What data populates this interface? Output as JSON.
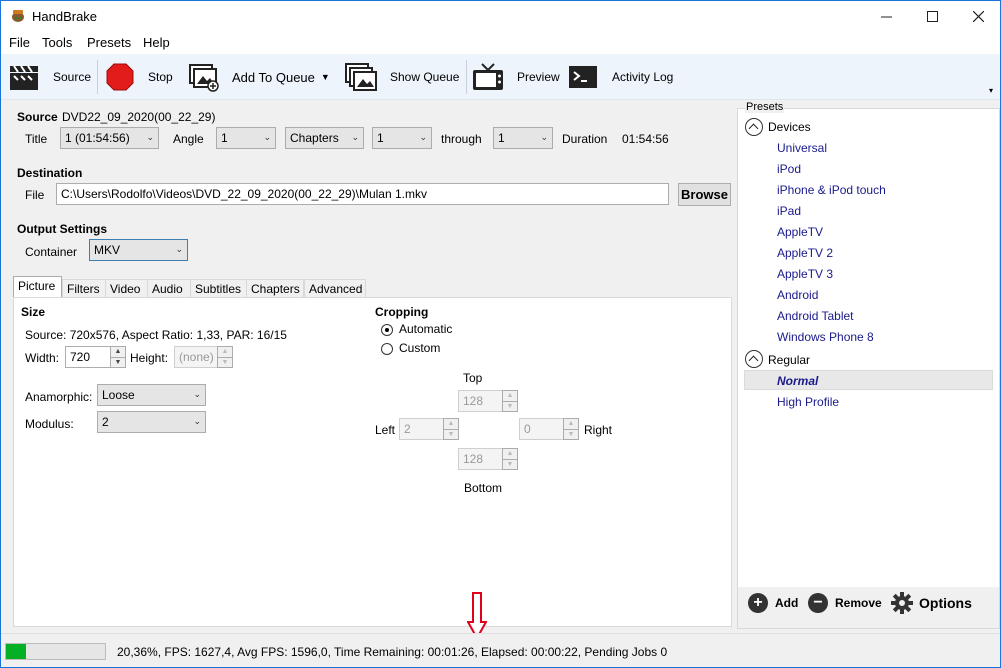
{
  "window": {
    "title": "HandBrake"
  },
  "menu": [
    "File",
    "Tools",
    "Presets",
    "Help"
  ],
  "toolbar": {
    "source": "Source",
    "stop": "Stop",
    "add_to_queue": "Add To Queue",
    "show_queue": "Show Queue",
    "preview": "Preview",
    "activity_log": "Activity Log"
  },
  "source": {
    "heading": "Source",
    "name": "DVD22_09_2020(00_22_29)",
    "title_label": "Title",
    "title_value": "1 (01:54:56)",
    "angle_label": "Angle",
    "angle_value": "1",
    "range_mode": "Chapters",
    "range_start": "1",
    "through_label": "through",
    "range_end": "1",
    "duration_label": "Duration",
    "duration_value": "01:54:56"
  },
  "destination": {
    "heading": "Destination",
    "file_label": "File",
    "file_path": "C:\\Users\\Rodolfo\\Videos\\DVD_22_09_2020(00_22_29)\\Mulan 1.mkv",
    "browse": "Browse"
  },
  "output": {
    "heading": "Output Settings",
    "container_label": "Container",
    "container_value": "MKV"
  },
  "tabs": [
    "Picture",
    "Filters",
    "Video",
    "Audio",
    "Subtitles",
    "Chapters",
    "Advanced"
  ],
  "picture": {
    "size_heading": "Size",
    "source_info": "Source:   720x576, Aspect Ratio: 1,33, PAR: 16/15",
    "width_label": "Width:",
    "width_value": "720",
    "height_label": "Height:",
    "height_placeholder": "(none)",
    "anamorphic_label": "Anamorphic:",
    "anamorphic_value": "Loose",
    "modulus_label": "Modulus:",
    "modulus_value": "2",
    "cropping_heading": "Cropping",
    "automatic": "Automatic",
    "custom": "Custom",
    "top_label": "Top",
    "top_value": "128",
    "left_label": "Left",
    "left_value": "2",
    "right_value": "0",
    "right_label": "Right",
    "bottom_value": "128",
    "bottom_label": "Bottom"
  },
  "presets": {
    "heading": "Presets",
    "devices_label": "Devices",
    "devices": [
      "Universal",
      "iPod",
      "iPhone & iPod touch",
      "iPad",
      "AppleTV",
      "AppleTV 2",
      "AppleTV 3",
      "Android",
      "Android Tablet",
      "Windows Phone 8"
    ],
    "regular_label": "Regular",
    "regular": [
      "Normal",
      "High Profile"
    ],
    "selected": "Normal",
    "add": "Add",
    "remove": "Remove",
    "options": "Options"
  },
  "status": {
    "progress_percent": 20.36,
    "text": "20,36%,  FPS: 1627,4,  Avg FPS: 1596,0,  Time Remaining: 00:01:26,  Elapsed: 00:00:22,  Pending Jobs 0"
  },
  "colors": {
    "progress": "#06b025",
    "annotation_arrow": "#e0001b",
    "preset_text": "#1a1a8c"
  }
}
